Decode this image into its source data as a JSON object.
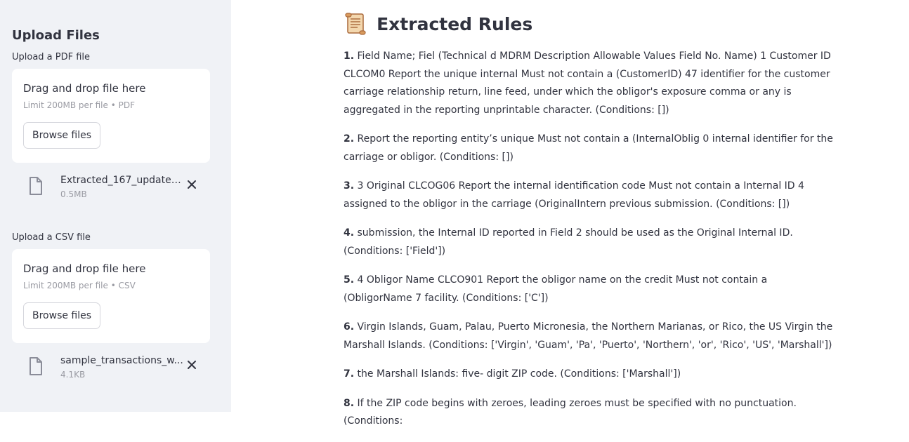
{
  "sidebar": {
    "title": "Upload Files",
    "pdf_upload": {
      "label": "Upload a PDF file",
      "drop_text": "Drag and drop file here",
      "limit": "Limit 200MB per file • PDF",
      "browse": "Browse files",
      "file": {
        "name": "Extracted_167_updated...",
        "size": "0.5MB"
      }
    },
    "csv_upload": {
      "label": "Upload a CSV file",
      "drop_text": "Drag and drop file here",
      "limit": "Limit 200MB per file • CSV",
      "browse": "Browse files",
      "file": {
        "name": "sample_transactions_w...",
        "size": "4.1KB"
      }
    }
  },
  "main": {
    "title_icon": "scroll-icon",
    "title": "Extracted Rules",
    "rules": [
      {
        "num": "1.",
        "text": "Field Name; Fiel (Technical d MDRM Description Allowable Values Field No. Name) 1 Customer ID CLCOM0 Report the unique internal Must not contain a (CustomerID) 47 identifier for the customer carriage relationship return, line feed, under which the obligor's exposure comma or any is aggregated in the reporting unprintable character. (Conditions: [])"
      },
      {
        "num": "2.",
        "text": "Report the reporting entity’s unique Must not contain a (InternalOblig 0 internal identifier for the carriage or obligor. (Conditions: [])"
      },
      {
        "num": "3.",
        "text": "3 Original CLCOG06 Report the internal identification code Must not contain a Internal ID 4 assigned to the obligor in the carriage (OriginalIntern previous submission. (Conditions: [])"
      },
      {
        "num": "4.",
        "text": "submission, the Internal ID reported in Field 2 should be used as the Original Internal ID. (Conditions: ['Field'])"
      },
      {
        "num": "5.",
        "text": "4 Obligor Name CLCO901 Report the obligor name on the credit Must not contain a (ObligorName 7 facility. (Conditions: ['C'])"
      },
      {
        "num": "6.",
        "text": "Virgin Islands, Guam, Palau, Puerto Micronesia, the Northern Marianas, or Rico, the US Virgin the Marshall Islands. (Conditions: ['Virgin', 'Guam', 'Pa', 'Puerto', 'Northern', 'or', 'Rico', 'US', 'Marshall'])"
      },
      {
        "num": "7.",
        "text": "the Marshall Islands: five- digit ZIP code. (Conditions: ['Marshall'])"
      },
      {
        "num": "8.",
        "text": "If the ZIP code begins with zeroes, leading zeroes must be specified with no punctuation. (Conditions:"
      }
    ]
  }
}
